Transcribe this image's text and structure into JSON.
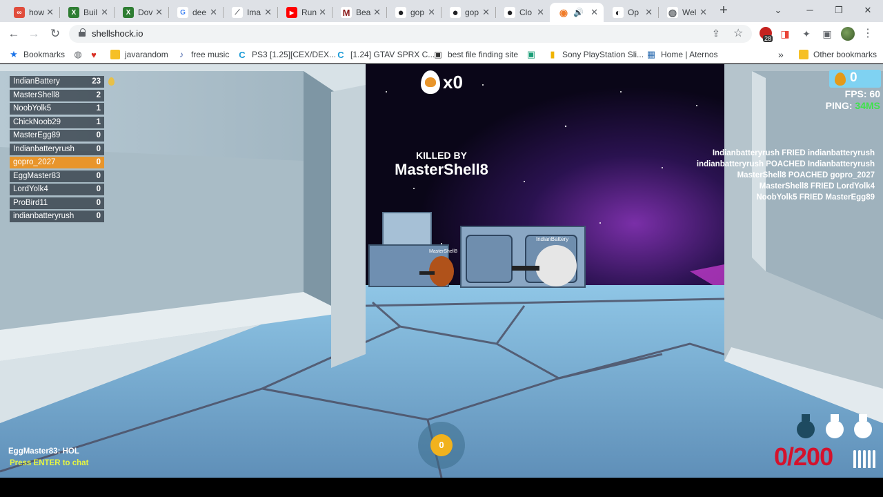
{
  "browser": {
    "tabs": [
      {
        "title": "how",
        "fav_color": "#e04c3c",
        "fav_glyph": "∞"
      },
      {
        "title": "Buil",
        "fav_color": "#2e7d32",
        "fav_glyph": "X"
      },
      {
        "title": "Dov",
        "fav_color": "#2e7d32",
        "fav_glyph": "X"
      },
      {
        "title": "dee",
        "fav_color": "#4285f4",
        "fav_glyph": "G"
      },
      {
        "title": "Ima",
        "fav_color": "#5f6368",
        "fav_glyph": "⟋"
      },
      {
        "title": "Run",
        "fav_color": "#ff0000",
        "fav_glyph": "▶"
      },
      {
        "title": "Bea",
        "fav_color": "#8b1a1a",
        "fav_glyph": "M"
      },
      {
        "title": "gop",
        "fav_color": "#202124",
        "fav_glyph": "●"
      },
      {
        "title": "gop",
        "fav_color": "#202124",
        "fav_glyph": "●"
      },
      {
        "title": "Clo",
        "fav_color": "#202124",
        "fav_glyph": "●"
      },
      {
        "title": "",
        "fav_color": "#f07c2a",
        "fav_glyph": "◉",
        "active": true,
        "audio": "🔊"
      },
      {
        "title": "Op",
        "fav_color": "#202124",
        "fav_glyph": "◐"
      },
      {
        "title": "Wel",
        "fav_color": "#5f6368",
        "fav_glyph": "◍"
      }
    ],
    "new_tab": "+",
    "window_controls": {
      "dropdown": "⌄",
      "minimize": "─",
      "restore": "❐",
      "close": "✕"
    },
    "url": "shellshock.io",
    "toolbar_icons": {
      "back": "←",
      "forward": "→",
      "reload": "↻",
      "share": "⇪",
      "star": "☆",
      "extensions": "✦",
      "sidepanel": "▣",
      "menu": "⋮"
    },
    "extension_badge": "28",
    "bookmarks": [
      {
        "label": "Bookmarks",
        "icon": "★",
        "icon_color": "#1a73e8"
      },
      {
        "label": "",
        "icon": "◍",
        "icon_color": "#5f6368"
      },
      {
        "label": "",
        "icon": "♥",
        "icon_color": "#d93025"
      },
      {
        "label": "javarandom",
        "icon": "▬",
        "icon_color": "#f6c026"
      },
      {
        "label": "free music",
        "icon": "♪",
        "icon_color": "#3c5aa6"
      },
      {
        "label": "PS3 [1.25][CEX/DEX...",
        "icon": "C",
        "icon_color": "#1a9ad6"
      },
      {
        "label": "[1.24] GTAV SPRX C...",
        "icon": "C",
        "icon_color": "#1a9ad6"
      },
      {
        "label": "best file finding site",
        "icon": "▣",
        "icon_color": "#333333"
      },
      {
        "label": "",
        "icon": "▣",
        "icon_color": "#1b9e77"
      },
      {
        "label": "Sony PlayStation Sli...",
        "icon": "▮",
        "icon_color": "#f0b400"
      },
      {
        "label": "Home | Aternos",
        "icon": "▦",
        "icon_color": "#2b6cb0"
      }
    ],
    "bookmarks_more": "»",
    "other_bookmarks": "Other bookmarks"
  },
  "game": {
    "scoreboard": [
      {
        "name": "IndianBattery",
        "score": "23",
        "leader": true
      },
      {
        "name": "MasterShell8",
        "score": "2"
      },
      {
        "name": "NoobYolk5",
        "score": "1"
      },
      {
        "name": "ChickNoob29",
        "score": "1"
      },
      {
        "name": "MasterEgg89",
        "score": "0"
      },
      {
        "name": "Indianbatteryrush",
        "score": "0"
      },
      {
        "name": "gopro_2027",
        "score": "0",
        "me": true
      },
      {
        "name": "EggMaster83",
        "score": "0"
      },
      {
        "name": "LordYolk4",
        "score": "0"
      },
      {
        "name": "ProBird11",
        "score": "0"
      },
      {
        "name": "indianbatteryrush",
        "score": "0"
      }
    ],
    "kill_streak": "x0",
    "killed_by_label": "KILLED BY",
    "killed_by_name": "MasterShell8",
    "golden_eggs": "0",
    "fps_label": "FPS: 60",
    "ping_label": "PING: ",
    "ping_value": "34MS",
    "kill_feed": [
      "Indianbatteryrush FRIED indianbatteryrush",
      "indianbatteryrush POACHED Indianbatteryrush",
      "MasterShell8 POACHED gopro_2027",
      "MasterShell8 FRIED LordYolk4",
      "NoobYolk5 FRIED MasterEgg89"
    ],
    "nametags": {
      "enemy_near": "MasterShell8",
      "enemy_far": "IndianBattery"
    },
    "chat_last": "EggMaster83: HOL",
    "chat_hint": "Press ENTER to chat",
    "grenades_center": "0",
    "ammo": "0/200",
    "grenades_shown": 3,
    "colors": {
      "accent_orange": "#e8952b",
      "ammo_red": "#d4122c",
      "ping_green": "#3ee34b",
      "chat_hint": "#e6f542"
    }
  }
}
